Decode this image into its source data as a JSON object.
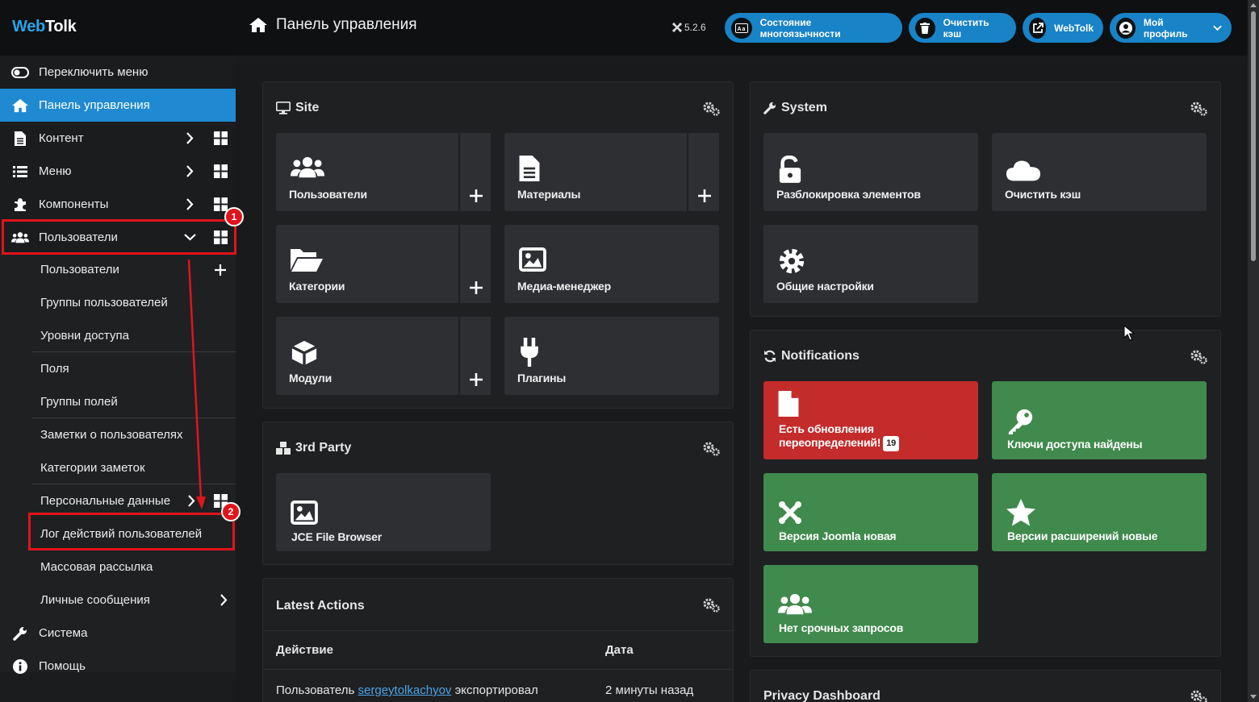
{
  "header": {
    "logo_part1": "Web",
    "logo_part2": "Tolk",
    "title": "Панель управления",
    "version": "5.2.6",
    "buttons": [
      {
        "label": "Состояние многоязычности",
        "icon": "language-icon"
      },
      {
        "label": "Очистить кэш",
        "icon": "trash-icon"
      },
      {
        "label": "WebTolk",
        "icon": "external-link-icon"
      },
      {
        "label": "Мой профиль",
        "icon": "user-circle-icon"
      }
    ]
  },
  "sidebar": {
    "toggle": "Переключить меню",
    "dashboard": "Панель управления",
    "content": "Контент",
    "menus": "Меню",
    "components": "Компоненты",
    "users": "Пользователи",
    "sub": [
      "Пользователи",
      "Группы пользователей",
      "Уровни доступа",
      "Поля",
      "Группы полей",
      "Заметки о пользователях",
      "Категории заметок",
      "Персональные данные",
      "Лог действий пользователей",
      "Массовая рассылка",
      "Личные сообщения"
    ],
    "system": "Система",
    "help": "Помощь"
  },
  "site": {
    "title": "Site",
    "tiles": [
      "Пользователи",
      "Материалы",
      "Категории",
      "Медиа-менеджер",
      "Модули",
      "Плагины"
    ]
  },
  "third_party": {
    "title": "3rd Party",
    "tiles": [
      "JCE File Browser"
    ]
  },
  "latest": {
    "title": "Latest Actions",
    "col_action": "Действие",
    "col_date": "Дата",
    "row_prefix": "Пользователь",
    "row_user": "sergeytolkachyov",
    "row_suffix": "экспортировал",
    "row_date": "2 минуты назад"
  },
  "system": {
    "title": "System",
    "tiles": [
      "Разблокировка элементов",
      "Очистить кэш",
      "Общие настройки"
    ]
  },
  "notifications": {
    "title": "Notifications",
    "tiles": [
      {
        "label1": "Есть обновления",
        "label2": "переопределений!",
        "badge": "19",
        "color": "#c42b2b"
      },
      {
        "label1": "Ключи доступа найдены",
        "color": "#3f8a4c"
      },
      {
        "label1": "Версия Joomla новая",
        "color": "#3f8a4c"
      },
      {
        "label1": "Версии расширений новые",
        "color": "#3f8a4c"
      },
      {
        "label1": "Нет срочных запросов",
        "color": "#3f8a4c"
      }
    ]
  },
  "privacy": {
    "title": "Privacy Dashboard"
  },
  "annotations": {
    "first": "1",
    "second": "2"
  },
  "colors": {
    "accent": "#1f8ad2",
    "header_btn": "#1883c7",
    "ok": "#3f8a4c",
    "alert": "#c42b2b",
    "marker": "#e0141c"
  }
}
